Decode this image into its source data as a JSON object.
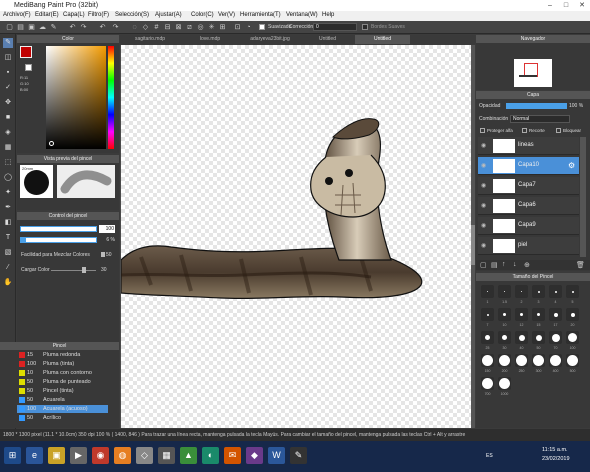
{
  "app": {
    "title": "MediBang Paint Pro (32bit)"
  },
  "menu": [
    "Archivo(F)",
    "Editar(E)",
    "Capa(L)",
    "Filtro(F)",
    "Selección(S)",
    "Ajustar(A)",
    "Color(C)",
    "Ver(V)",
    "Herramienta(T)",
    "Ventana(W)",
    "Help"
  ],
  "toolbar": {
    "smooth_label": "Suavizado",
    "correction_label": "Corrección",
    "correction_value": "0",
    "soft_edges_label": "Bordes Suaves"
  },
  "tabs": [
    "sagitario.mdp",
    "love.mdp",
    "adaryeva23bit.jpg",
    "Untitled",
    "Untitled"
  ],
  "color_panel": {
    "title": "Color",
    "r": "R:11",
    "g": "G:10",
    "b": "B:00",
    "primary_color": "#c00000",
    "secondary_color": "#ffffff"
  },
  "brush_preview": {
    "title": "Vista previa del pincel",
    "size_label": "20mm"
  },
  "brush_control": {
    "title": "Control del pincel",
    "size_value": "100",
    "opacity_value": "6 %",
    "mix_label": "Facilidad para Mezclar Colores",
    "mix_value": "50",
    "load_label": "Cargar Color",
    "load_value": "30"
  },
  "brush_list": {
    "title": "Pincel",
    "items": [
      {
        "size": "15",
        "name": "Pluma redonda",
        "color": "#d22"
      },
      {
        "size": "100",
        "name": "Pluma (tinta)",
        "color": "#d22"
      },
      {
        "size": "10",
        "name": "Pluma con contorno",
        "color": "#dd0"
      },
      {
        "size": "50",
        "name": "Pluma de punteado",
        "color": "#dd0"
      },
      {
        "size": "50",
        "name": "Pincel (tinta)",
        "color": "#dd0"
      },
      {
        "size": "50",
        "name": "Acuarela",
        "color": "#39f"
      },
      {
        "size": "100",
        "name": "Acuarela (acuoso)",
        "color": "#39f",
        "selected": true
      },
      {
        "size": "50",
        "name": "Acrílico",
        "color": "#39f"
      }
    ]
  },
  "navigator": {
    "title": "Navegador"
  },
  "layers_panel": {
    "title": "Capa",
    "opacity_label": "Opacidad",
    "opacity_value": "100 %",
    "blend_label": "Combinación",
    "blend_value": "Normal",
    "protect_alpha": "Proteger alfa",
    "clip": "Recorte",
    "lock": "Bloquear",
    "layers": [
      {
        "name": "lineas"
      },
      {
        "name": "Capa10",
        "selected": true
      },
      {
        "name": "Capa7"
      },
      {
        "name": "Capa6"
      },
      {
        "name": "Capa9"
      },
      {
        "name": "piel"
      }
    ]
  },
  "brush_size_panel": {
    "title": "Tamaño del Pincel",
    "sizes": [
      "1",
      "1.5",
      "2",
      "3",
      "4",
      "5",
      "7",
      "10",
      "12",
      "15",
      "17",
      "20",
      "25",
      "30",
      "40",
      "50",
      "70",
      "100",
      "150",
      "200",
      "250",
      "300",
      "400",
      "500",
      "700",
      "1000"
    ]
  },
  "status": {
    "text": "1800 * 1300 pixel   (11.1 * 10.0cm)   350 dpi   100 %   ( 1400, 846 )   Para trazar una línea recta, mantenga pulsada la tecla Mayús. Para cambiar el tamaño del pincel, mantenga pulsada las teclas Ctrl + Alt y arrastre"
  },
  "taskbar": {
    "lang": "ES",
    "time": "11:15 a.m.",
    "date": "23/02/2019"
  }
}
